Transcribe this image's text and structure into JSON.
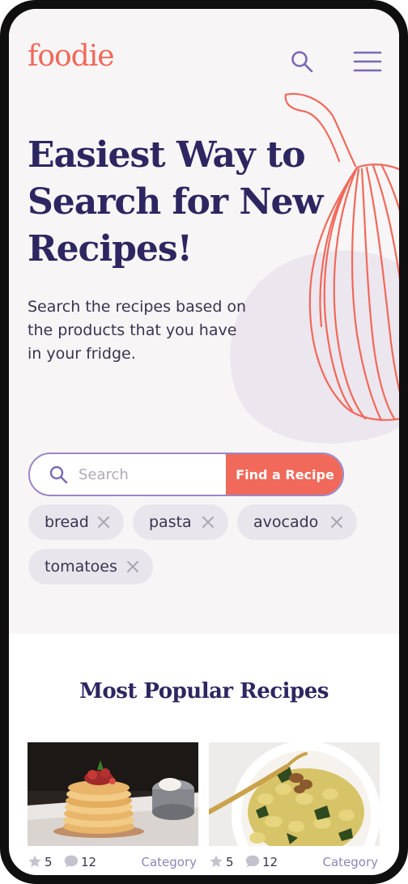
{
  "header": {
    "logo": "foodie",
    "search_icon": "search-icon",
    "menu_icon": "hamburger-menu-icon"
  },
  "hero": {
    "headline_line1": "Easiest Way to",
    "headline_line2": "Search for New",
    "headline_line3": "Recipes!",
    "subtext_line1": "Search the recipes based on",
    "subtext_line2": "the products that you have",
    "subtext_line3": "in your fridge."
  },
  "search": {
    "placeholder": "Search",
    "button_label": "Find a Recipe"
  },
  "ingredients": [
    {
      "label": "bread"
    },
    {
      "label": "pasta"
    },
    {
      "label": "avocado"
    },
    {
      "label": "tomatoes"
    }
  ],
  "popular": {
    "title": "Most Popular Recipes",
    "recipes": [
      {
        "image": "pancake-stack-photo",
        "stars": "5",
        "comments": "12",
        "category": "Category"
      },
      {
        "image": "gnocchi-pasta-photo",
        "stars": "5",
        "comments": "12",
        "category": "Category"
      }
    ]
  },
  "colors": {
    "accent": "#f0695a",
    "heading": "#2d2660",
    "outline": "#9b86c6",
    "chip_bg": "#e8e6ec",
    "hero_bg": "#f8f5f6"
  }
}
